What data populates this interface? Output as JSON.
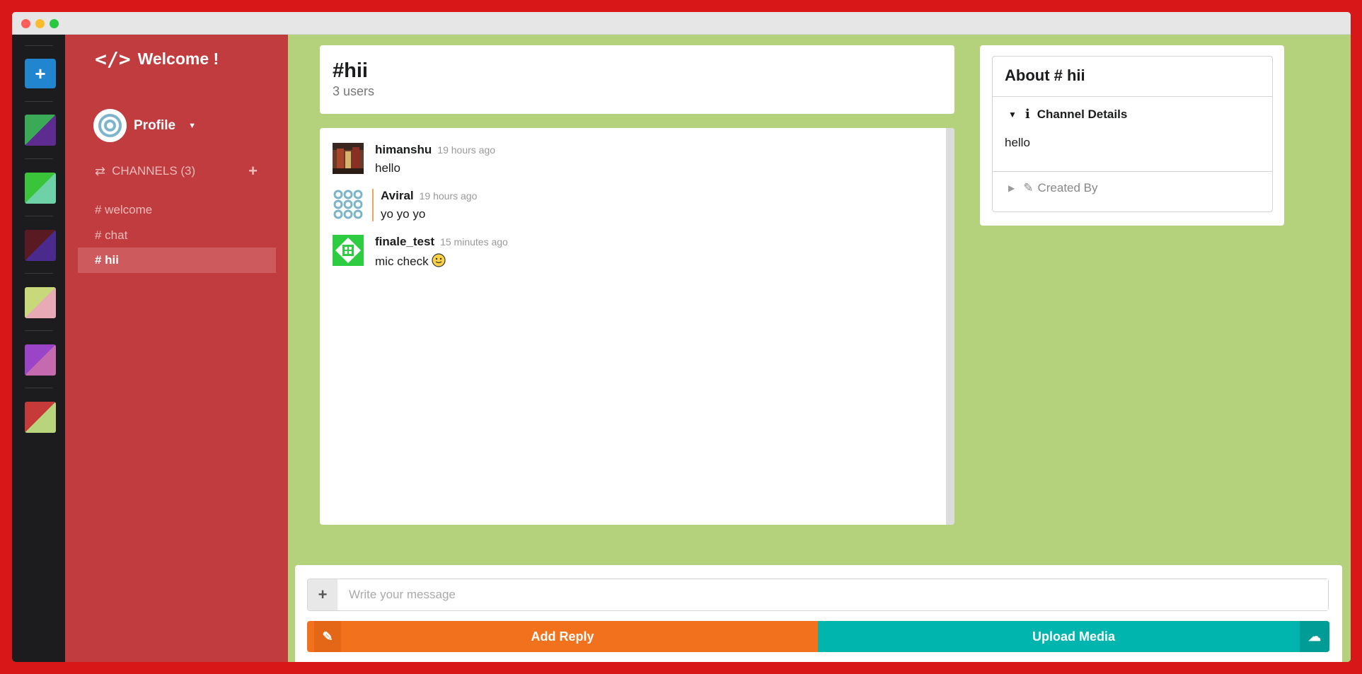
{
  "sidebar": {
    "brand_icon": "</>",
    "brand_title": "Welcome !",
    "profile_label": "Profile",
    "channels_header": "CHANNELS (3)",
    "channels": [
      "# welcome",
      "# chat",
      "# hii"
    ],
    "active_channel": "# hii"
  },
  "rail": {
    "add_label": "+",
    "swatches": [
      {
        "a": "#5e2b90",
        "b": "#3aaa56"
      },
      {
        "a": "#6fd1a8",
        "b": "#3ac43a"
      },
      {
        "a": "#4a2a8c",
        "b": "#5a1a22"
      },
      {
        "a": "#e8aab4",
        "b": "#c8d87a"
      },
      {
        "a": "#c66ab0",
        "b": "#9a45c8"
      },
      {
        "a": "#b8d47c",
        "b": "#c63a3a"
      }
    ]
  },
  "header": {
    "title": "#hii",
    "users": "3 users"
  },
  "messages": [
    {
      "author": "himanshu",
      "time": "19 hours ago",
      "text": "hello",
      "avatar": "photo"
    },
    {
      "author": "Aviral",
      "time": "19 hours ago",
      "text": "yo yo yo",
      "avatar": "pattern-blue"
    },
    {
      "author": "finale_test",
      "time": "15 minutes ago",
      "text": "mic check",
      "avatar": "pattern-green",
      "emoji": "smile-icon"
    }
  ],
  "about": {
    "title": "About # hii",
    "details_label": "Channel Details",
    "details_text": "hello",
    "created_by_label": "Created By"
  },
  "composer": {
    "placeholder": "Write your message",
    "reply_label": "Add Reply",
    "upload_label": "Upload Media"
  },
  "colors": {
    "sidebar": "#c13c3f",
    "background": "#b4d27c",
    "reply": "#f2711c",
    "upload": "#00b5ad"
  }
}
